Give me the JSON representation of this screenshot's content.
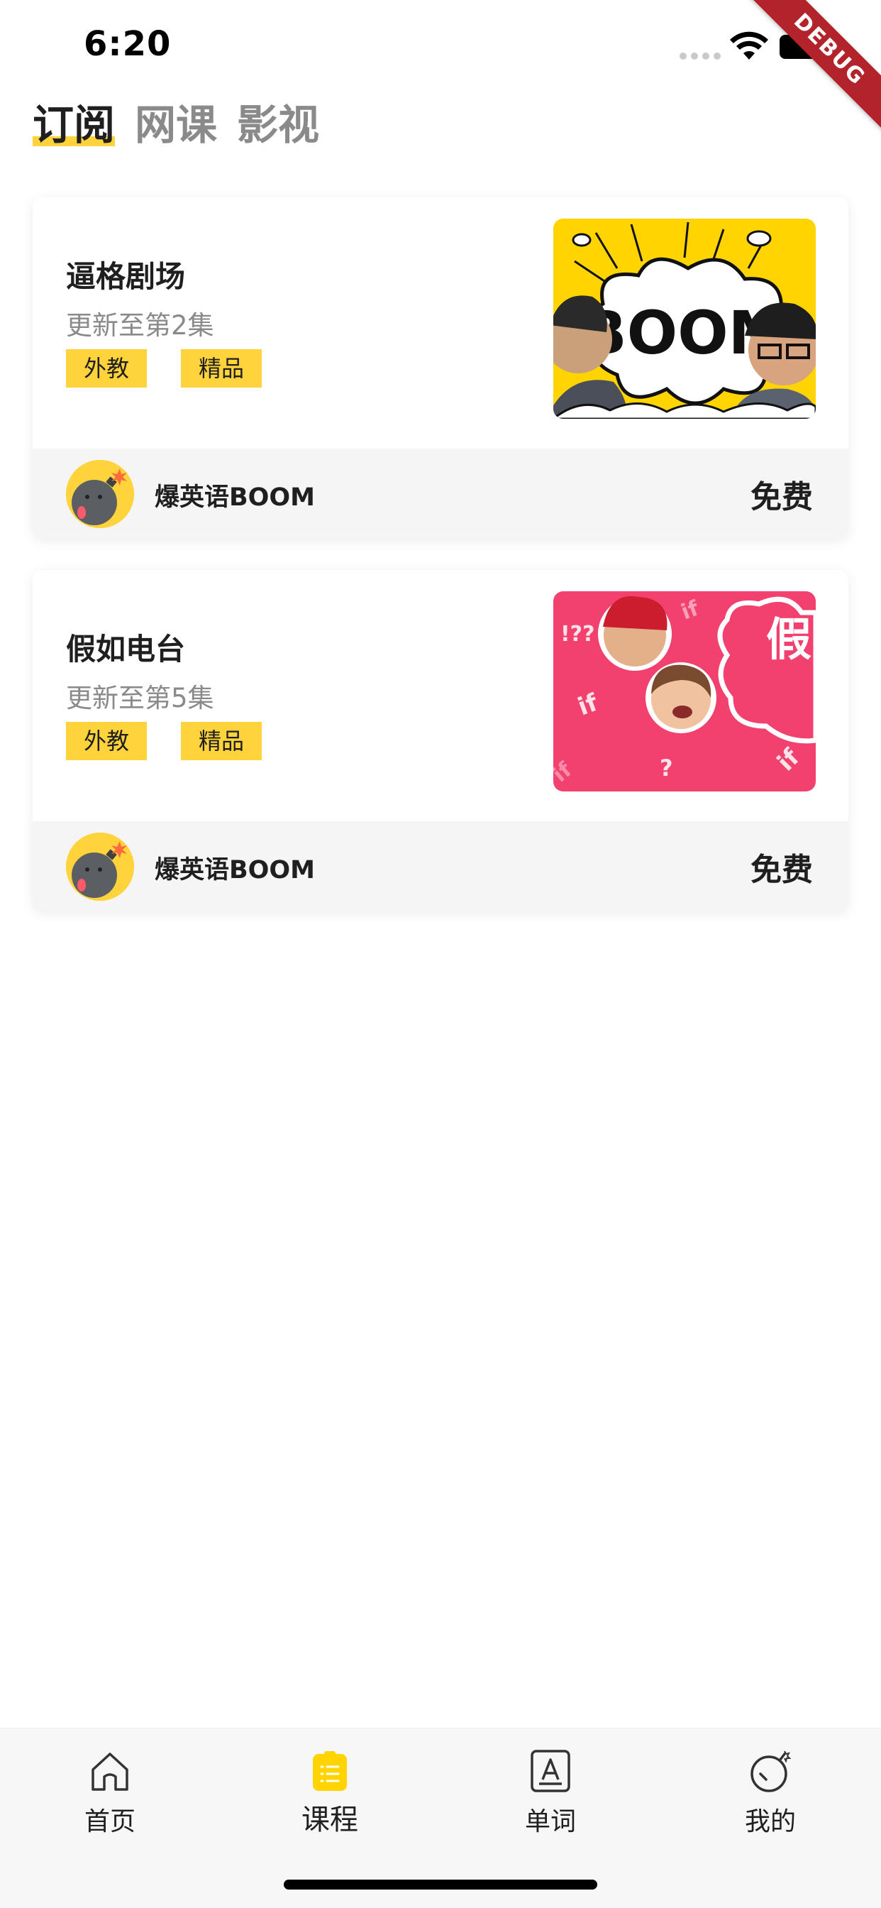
{
  "status_bar": {
    "time": "6:20",
    "debug_banner": "DEBUG"
  },
  "top_tabs": [
    {
      "label": "订阅",
      "active": true
    },
    {
      "label": "网课",
      "active": false
    },
    {
      "label": "影视",
      "active": false
    }
  ],
  "courses": [
    {
      "title": "逼格剧场",
      "subtitle": "更新至第2集",
      "tags": [
        "外教",
        "精品"
      ],
      "thumbnail_text": "BOOM",
      "author": "爆英语BOOM",
      "price": "免费"
    },
    {
      "title": "假如电台",
      "subtitle": "更新至第5集",
      "tags": [
        "外教",
        "精品"
      ],
      "thumbnail_text": "假电",
      "author": "爆英语BOOM",
      "price": "免费"
    }
  ],
  "bottom_nav": [
    {
      "label": "首页",
      "icon": "home-icon",
      "active": false
    },
    {
      "label": "课程",
      "icon": "course-icon",
      "active": true
    },
    {
      "label": "单词",
      "icon": "word-icon",
      "active": false
    },
    {
      "label": "我的",
      "icon": "bomb-icon",
      "active": false
    }
  ],
  "colors": {
    "accent": "#ffd33b",
    "thumb_pink": "#f2406f",
    "debug": "#b3232b"
  }
}
